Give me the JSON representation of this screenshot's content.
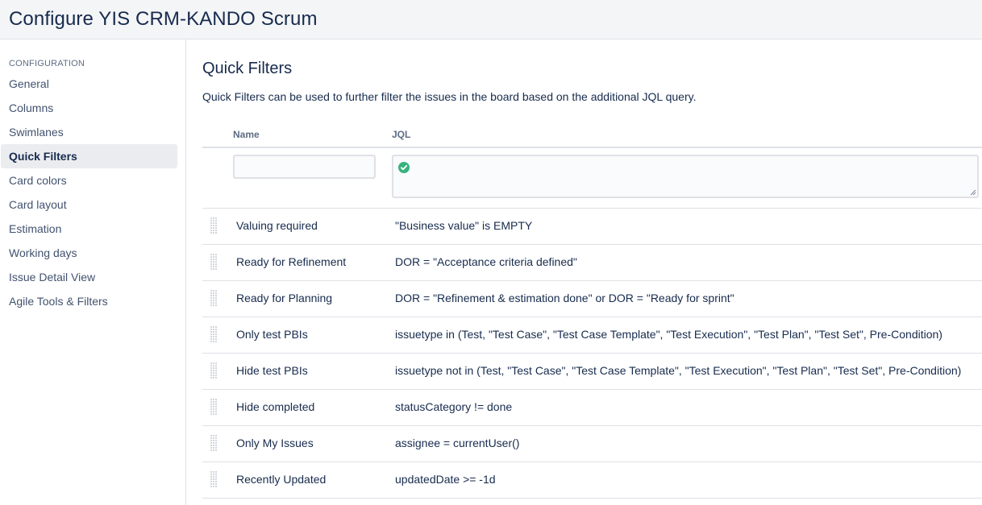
{
  "header": {
    "title": "Configure YIS CRM-KANDO Scrum"
  },
  "sidebar": {
    "section_label": "CONFIGURATION",
    "items": [
      {
        "label": "General"
      },
      {
        "label": "Columns"
      },
      {
        "label": "Swimlanes"
      },
      {
        "label": "Quick Filters"
      },
      {
        "label": "Card colors"
      },
      {
        "label": "Card layout"
      },
      {
        "label": "Estimation"
      },
      {
        "label": "Working days"
      },
      {
        "label": "Issue Detail View"
      },
      {
        "label": "Agile Tools & Filters"
      }
    ],
    "active": "Quick Filters"
  },
  "main": {
    "title": "Quick Filters",
    "description": "Quick Filters can be used to further filter the issues in the board based on the additional JQL query.",
    "columns": {
      "name": "Name",
      "jql": "JQL"
    },
    "new_filter": {
      "name_value": "",
      "jql_value": "",
      "jql_status": "valid"
    },
    "filters": [
      {
        "name": "Valuing required",
        "jql": "\"Business value\" is EMPTY"
      },
      {
        "name": "Ready for Refinement",
        "jql": "DOR = \"Acceptance criteria defined\""
      },
      {
        "name": "Ready for Planning",
        "jql": "DOR = \"Refinement & estimation done\" or DOR = \"Ready for sprint\""
      },
      {
        "name": "Only test PBIs",
        "jql": "issuetype in (Test, \"Test Case\", \"Test Case Template\", \"Test Execution\", \"Test Plan\", \"Test Set\", Pre-Condition)"
      },
      {
        "name": "Hide test PBIs",
        "jql": "issuetype not in (Test, \"Test Case\", \"Test Case Template\", \"Test Execution\", \"Test Plan\", \"Test Set\", Pre-Condition)"
      },
      {
        "name": "Hide completed",
        "jql": "statusCategory != done"
      },
      {
        "name": "Only My Issues",
        "jql": "assignee = currentUser()"
      },
      {
        "name": "Recently Updated",
        "jql": "updatedDate >= -1d"
      }
    ]
  },
  "colors": {
    "accent_bg": "#ebecf0",
    "valid_green": "#36b37e",
    "border": "#dfe1e6"
  }
}
